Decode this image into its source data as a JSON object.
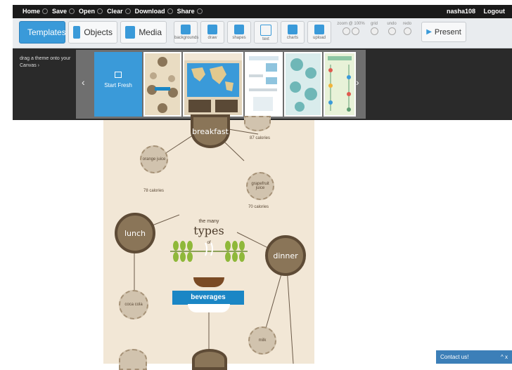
{
  "topbar": {
    "menu": [
      "Home",
      "Save",
      "Open",
      "Clear",
      "Download",
      "Share"
    ],
    "user": "nasha108",
    "logout": "Logout"
  },
  "toolbar": {
    "tabs": [
      "Templates",
      "Objects",
      "Media"
    ],
    "tools": [
      "backgrounds",
      "draw",
      "shapes",
      "text",
      "charts",
      "upload"
    ],
    "zoom_label": "zoom @ 100%",
    "grid_label": "grid",
    "undo_label": "undo",
    "redo_label": "redo",
    "present_label": "Present"
  },
  "templates_strip": {
    "prompt": "drag a theme onto your Canvas ›",
    "start_fresh": "Start Fresh",
    "thumb_titles": [
      "",
      "",
      "",
      "",
      "",
      ""
    ]
  },
  "canvas": {
    "title_small": "the many",
    "title_big": "types",
    "title_of": "of",
    "ribbon": "beverages",
    "nodes": {
      "breakfast": "breakfast",
      "lunch": "lunch",
      "dinner": "dinner",
      "orange_juice": "orange juice",
      "orange_cal": "78 calories",
      "grapefruit_juice": "grapefruit juice",
      "grapefruit_cal": "70 calories",
      "top_cal": "87 calories",
      "coca_cola": "coca cola",
      "milk": "milk"
    }
  },
  "contact": {
    "label": "Contact us!",
    "controls": "^ x"
  }
}
